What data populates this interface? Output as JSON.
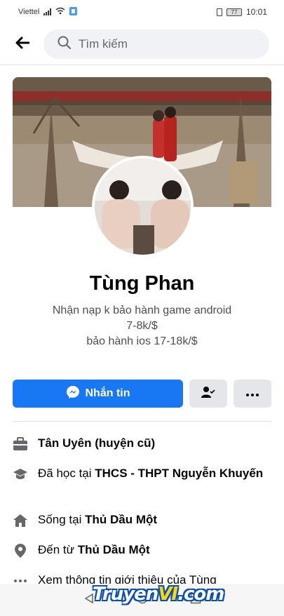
{
  "status_bar": {
    "carrier": "Viettel",
    "battery": "77",
    "time": "10:01"
  },
  "search": {
    "placeholder": "Tìm kiếm"
  },
  "profile": {
    "name": "Tùng Phan",
    "bio_lines": [
      "Nhận nạp  k bảo hành game android",
      "7-8k/$",
      "bảo hành ios 17-18k/$"
    ]
  },
  "actions": {
    "message_label": "Nhắn tin"
  },
  "info": {
    "work": "Tân Uyên (huyện cũ)",
    "education_prefix": "Đã học tại ",
    "education_place": "THCS - THPT Nguyễn Khuyến",
    "lives_prefix": "Sống tại ",
    "lives_place": "Thủ Dầu Một",
    "from_prefix": "Đến từ ",
    "from_place": "Thủ Dầu Một",
    "see_about": "Xem thông tin giới thiệu của Tùng"
  },
  "watermark": {
    "part1": "Truyen",
    "part2": "VI",
    "part3": ".com"
  },
  "colors": {
    "accent": "#1877f2",
    "button_gray": "#e4e6eb",
    "search_bg": "#f0f2f5"
  }
}
